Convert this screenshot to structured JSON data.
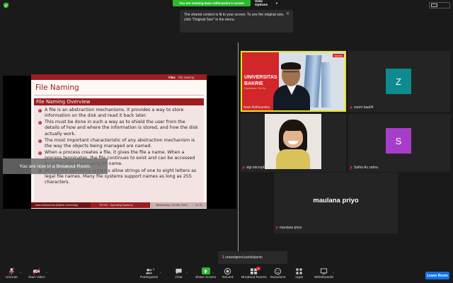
{
  "top": {
    "viewing_banner": "You are viewing Iwan Adhicandra's screen",
    "view_options": "View Options",
    "tooltip_text": "The shared content is fit to your screen. To see the original size, click \"Original Size\" in the menu."
  },
  "slide": {
    "topbar_section": "Files",
    "topbar_sub": "File Naming",
    "title": "File Naming",
    "block_title": "File Naming Overview",
    "bullets": [
      "A file is an abstraction mechanisms. It provides a way to store information on the disk and read it back later.",
      "This must be done in such a way as to shield the user from the details of how and where the information is stored, and how the disk actually work.",
      "The most important characteristic of any abstraction mechanism is the way the objects being managed are named.",
      "When a process creates a file, it gives the file a name. When a process terminates, the file continues to exist and can be accessed by other processes using its name.",
      "All current operating systems allow strings of one to eight letters as legal file names. Many file systems support names as long as 255 characters."
    ],
    "footer_left": "Iwan Adhicandra (Bakrie University)",
    "footer_mid": "TIF206 : Operating Systems",
    "footer_date": "Wednesday, Oct 5th, 2022",
    "footer_page": "6 / 47"
  },
  "breakout_toast": "You are now in a Breakout Room.",
  "participants": {
    "iwan": {
      "name": "Iwan Adhicandra",
      "bg_text": "UNIVERSITAS\nBAKRIE",
      "bg_sub": "Experience The Ne...",
      "logo": "BAKRIE"
    },
    "zoom": {
      "name": "zoom baa04",
      "initial": "Z",
      "color": "#0d8b8e"
    },
    "sigi": {
      "name": "sigi microphone"
    },
    "safira": {
      "name": "Safira Az zahra",
      "initial": "S",
      "color": "#a73ec9"
    },
    "maulana": {
      "name": "maulana priyo",
      "display": "maulana priyo"
    }
  },
  "unassigned": "1 unassigned participants",
  "toolbar": {
    "unmute": "Unmute",
    "start_video": "Start Video",
    "participants": "Participants",
    "participants_count": "5",
    "chat": "Chat",
    "share_screen": "Share Screen",
    "record": "Record",
    "breakout_rooms": "Breakout Rooms",
    "reactions": "Reactions",
    "apps": "Apps",
    "whiteboards": "Whiteboards",
    "leave": "Leave Room"
  },
  "colors": {
    "accent_green": "#2eb82e",
    "slide_red": "#9b1d20",
    "leave_blue": "#0e71eb",
    "active_speaker": "#e8e61d"
  }
}
